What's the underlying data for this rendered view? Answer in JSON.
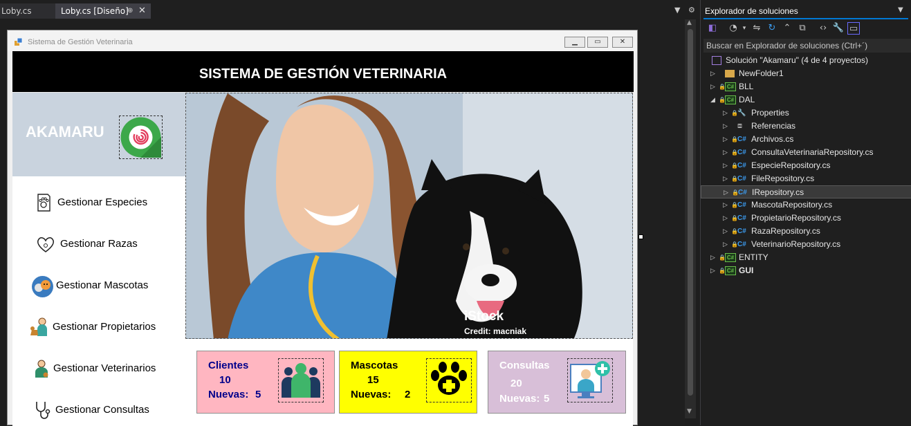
{
  "tabs": [
    {
      "label": "Loby.cs",
      "active": false
    },
    {
      "label": "Loby.cs [Diseño]",
      "active": true
    }
  ],
  "form": {
    "window_title": "Sistema de Gestión Veterinaria",
    "header": "SISTEMA DE GESTIÓN VETERINARIA",
    "brand": "AKAMARU",
    "nav": [
      {
        "label": "Gestionar Especies",
        "icon": "paw-paper-icon"
      },
      {
        "label": "Gestionar Razas",
        "icon": "heart-paw-icon"
      },
      {
        "label": "Gestionar Mascotas",
        "icon": "pets-avatar-icon"
      },
      {
        "label": "Gestionar Propietarios",
        "icon": "owner-with-dog-icon"
      },
      {
        "label": "Gestionar Veterinarios",
        "icon": "veterinarian-icon"
      },
      {
        "label": "Gestionar Consultas",
        "icon": "stethoscope-paw-icon"
      }
    ],
    "photo": {
      "watermark": "iStock",
      "credit": "Credit: macniak"
    },
    "cards": [
      {
        "title": "Clientes",
        "count": "10",
        "new_label": "Nuevas:",
        "new_value": "5",
        "bg": "#ffb6c1",
        "fg": "#00008b",
        "icon": "people-icon"
      },
      {
        "title": "Mascotas",
        "count": "15",
        "new_label": "Nuevas:",
        "new_value": "2",
        "bg": "#ffff00",
        "fg": "#000000",
        "icon": "paw-plus-icon"
      },
      {
        "title": "Consultas",
        "count": "20",
        "new_label": "Nuevas:",
        "new_value": "5",
        "bg": "#d8bfd8",
        "fg": "#ffffff",
        "icon": "doctor-monitor-icon"
      }
    ]
  },
  "solution_explorer": {
    "title": "Explorador de soluciones",
    "search_placeholder": "Buscar en Explorador de soluciones (Ctrl+´)",
    "tree": [
      {
        "label": "Solución \"Akamaru\"  (4 de 4 proyectos)",
        "level": 0,
        "arrow": "",
        "kind": "solution"
      },
      {
        "label": "NewFolder1",
        "level": 1,
        "arrow": "▷",
        "kind": "folder"
      },
      {
        "label": "BLL",
        "level": 1,
        "arrow": "▷",
        "kind": "project"
      },
      {
        "label": "DAL",
        "level": 1,
        "arrow": "◢",
        "kind": "project"
      },
      {
        "label": "Properties",
        "level": 2,
        "arrow": "▷",
        "kind": "properties"
      },
      {
        "label": "Referencias",
        "level": 2,
        "arrow": "▷",
        "kind": "references"
      },
      {
        "label": "Archivos.cs",
        "level": 2,
        "arrow": "▷",
        "kind": "csfile"
      },
      {
        "label": "ConsultaVeterinariaRepository.cs",
        "level": 2,
        "arrow": "▷",
        "kind": "csfile"
      },
      {
        "label": "EspecieRepository.cs",
        "level": 2,
        "arrow": "▷",
        "kind": "csfile"
      },
      {
        "label": "FileRepository.cs",
        "level": 2,
        "arrow": "▷",
        "kind": "csfile"
      },
      {
        "label": "IRepository.cs",
        "level": 2,
        "arrow": "▷",
        "kind": "csfile",
        "selected": true
      },
      {
        "label": "MascotaRepository.cs",
        "level": 2,
        "arrow": "▷",
        "kind": "csfile"
      },
      {
        "label": "PropietarioRepository.cs",
        "level": 2,
        "arrow": "▷",
        "kind": "csfile"
      },
      {
        "label": "RazaRepository.cs",
        "level": 2,
        "arrow": "▷",
        "kind": "csfile"
      },
      {
        "label": "VeterinarioRepository.cs",
        "level": 2,
        "arrow": "▷",
        "kind": "csfile"
      },
      {
        "label": "ENTITY",
        "level": 1,
        "arrow": "▷",
        "kind": "project"
      },
      {
        "label": "GUI",
        "level": 1,
        "arrow": "▷",
        "kind": "project",
        "bold": true
      }
    ]
  }
}
